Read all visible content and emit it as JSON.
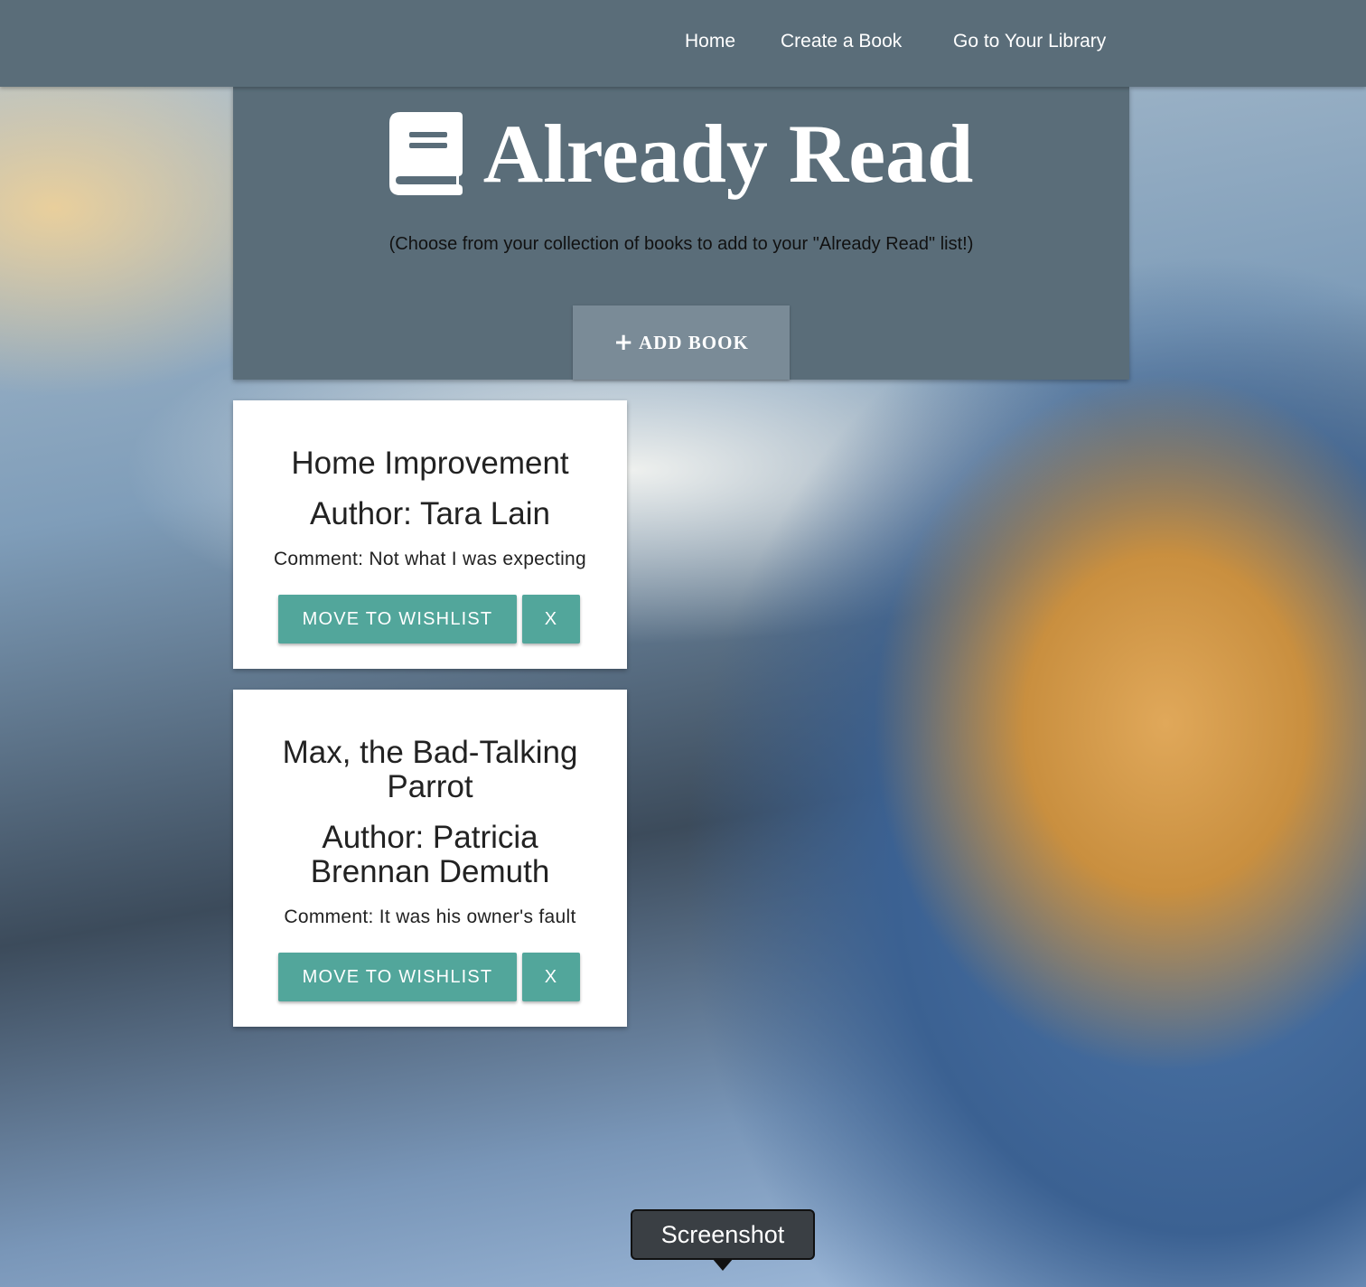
{
  "nav": {
    "home": "Home",
    "create": "Create a Book",
    "library": "Go to Your Library"
  },
  "header": {
    "icon": "book-icon",
    "title": "Already Read",
    "subtitle": "(Choose from your collection of books to add to your \"Already Read\" list!)",
    "add_button_icon": "plus-icon",
    "add_button_label": "ADD BOOK"
  },
  "books": [
    {
      "title": "Home Improvement",
      "author": "Author: Tara Lain",
      "comment": "Comment: Not what I was expecting",
      "move_label": "MOVE TO WISHLIST",
      "remove_label": "X"
    },
    {
      "title": "Max, the Bad-Talking Parrot",
      "author": "Author: Patricia Brennan Demuth",
      "comment": "Comment: It was his owner's fault",
      "move_label": "MOVE TO WISHLIST",
      "remove_label": "X"
    }
  ],
  "tooltip": {
    "text": "Screenshot"
  },
  "colors": {
    "navbar": "#5a6d79",
    "add_button": "#7a8b97",
    "accent_button": "#52a69b",
    "card": "#ffffff"
  }
}
